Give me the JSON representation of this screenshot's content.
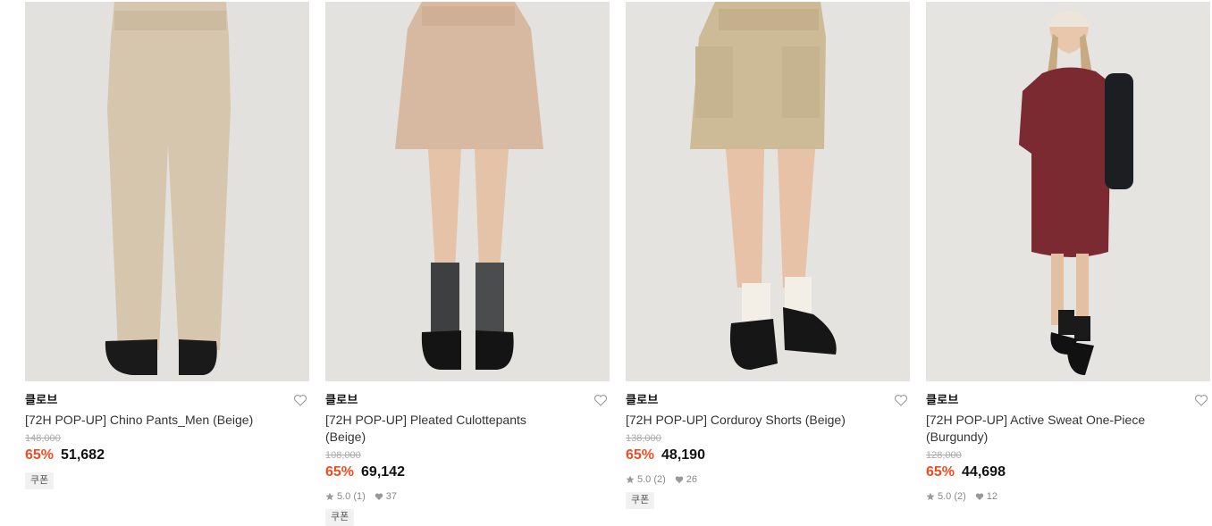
{
  "products": [
    {
      "brand": "클로브",
      "title": "[72H POP-UP] Chino Pants_Men (Beige)",
      "original_price": "148,000",
      "discount": "65%",
      "price": "51,682",
      "rating": null,
      "likes": null,
      "coupon": "쿠폰",
      "image": "beige-chino-pants-photo"
    },
    {
      "brand": "클로브",
      "title": "[72H POP-UP] Pleated Culottepants (Beige)",
      "original_price": "108,000",
      "discount": "65%",
      "price": "69,142",
      "rating": "5.0 (1)",
      "likes": "37",
      "coupon": "쿠폰",
      "image": "beige-pleated-culottes-photo"
    },
    {
      "brand": "클로브",
      "title": "[72H POP-UP] Corduroy Shorts (Beige)",
      "original_price": "138,000",
      "discount": "65%",
      "price": "48,190",
      "rating": "5.0 (2)",
      "likes": "26",
      "coupon": "쿠폰",
      "image": "beige-corduroy-shorts-photo"
    },
    {
      "brand": "클로브",
      "title": "[72H POP-UP] Active Sweat One-Piece (Burgundy)",
      "original_price": "128,000",
      "discount": "65%",
      "price": "44,698",
      "rating": "5.0 (2)",
      "likes": "12",
      "coupon": null,
      "image": "burgundy-sweat-dress-photo"
    }
  ],
  "colors": {
    "discount": "#f04b22",
    "photo_bg": "#e4e3e0",
    "beige": "#d9c7ad",
    "burgundy": "#7a2a30"
  },
  "icons": {
    "wishlist": "heart-outline-icon",
    "rating": "star-icon",
    "likes": "heart-filled-icon"
  }
}
